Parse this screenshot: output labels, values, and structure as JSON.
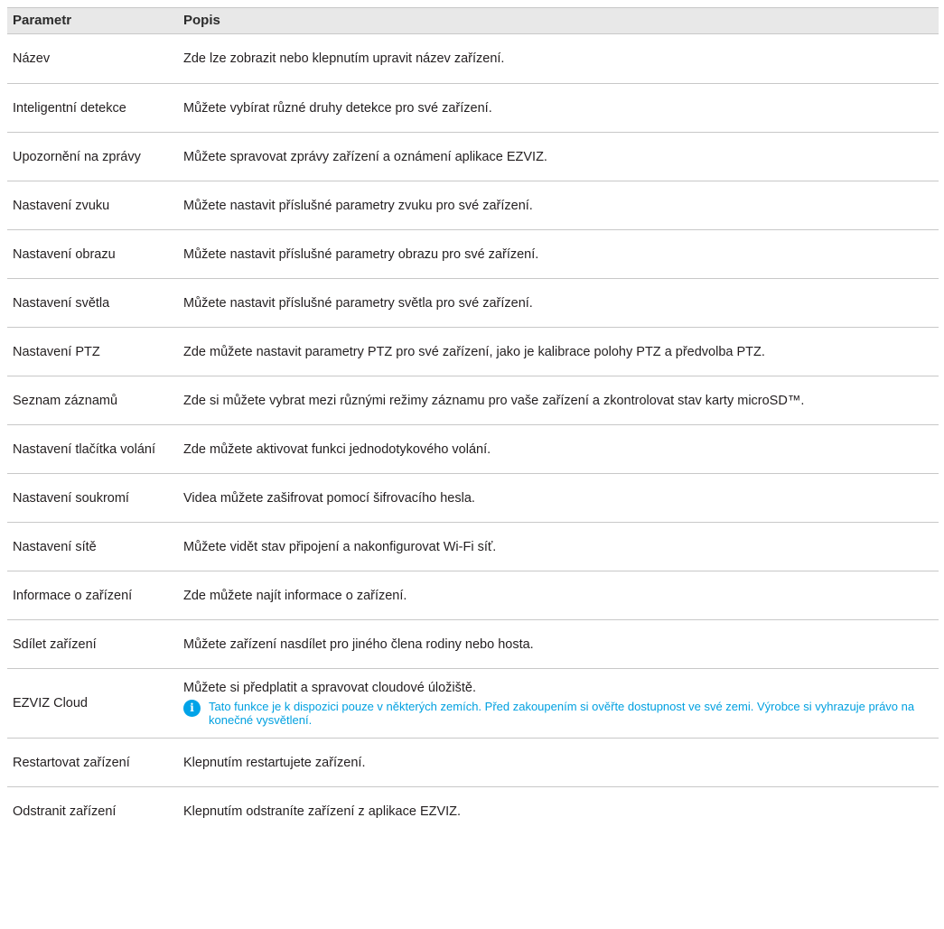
{
  "header": {
    "param": "Parametr",
    "desc": "Popis"
  },
  "rows": [
    {
      "param": "Název",
      "desc": "Zde lze zobrazit nebo klepnutím upravit název zařízení."
    },
    {
      "param": "Inteligentní detekce",
      "desc": "Můžete vybírat různé druhy detekce pro své zařízení."
    },
    {
      "param": "Upozornění na zprávy",
      "desc": "Můžete spravovat zprávy zařízení a oznámení aplikace EZVIZ."
    },
    {
      "param": "Nastavení zvuku",
      "desc": "Můžete nastavit příslušné parametry zvuku pro své zařízení."
    },
    {
      "param": "Nastavení obrazu",
      "desc": "Můžete nastavit příslušné parametry obrazu pro své zařízení."
    },
    {
      "param": "Nastavení světla",
      "desc": "Můžete nastavit příslušné parametry světla pro své zařízení."
    },
    {
      "param": "Nastavení PTZ",
      "desc": "Zde můžete nastavit parametry PTZ pro své zařízení, jako je kalibrace polohy PTZ a předvolba PTZ."
    },
    {
      "param": "Seznam záznamů",
      "desc": "Zde si můžete vybrat mezi různými režimy záznamu pro vaše zařízení a zkontrolovat stav karty microSD™."
    },
    {
      "param": "Nastavení tlačítka volání",
      "desc": "Zde můžete aktivovat funkci jednodotykového volání."
    },
    {
      "param": "Nastavení soukromí",
      "desc": "Videa můžete zašifrovat pomocí šifrovacího hesla."
    },
    {
      "param": "Nastavení sítě",
      "desc": "Můžete vidět stav připojení a nakonfigurovat Wi-Fi síť."
    },
    {
      "param": "Informace o zařízení",
      "desc": "Zde můžete najít informace o zařízení."
    },
    {
      "param": "Sdílet zařízení",
      "desc": "Můžete zařízení nasdílet pro jiného člena rodiny nebo hosta."
    },
    {
      "param": "EZVIZ Cloud",
      "desc": "Můžete si předplatit a spravovat cloudové úložiště.",
      "note": "Tato funkce je k dispozici pouze v některých zemích. Před zakoupením si ověřte dostupnost ve své zemi. Výrobce si vyhrazuje právo na konečné vysvětlení.",
      "note_icon": "i"
    },
    {
      "param": "Restartovat zařízení",
      "desc": "Klepnutím restartujete zařízení."
    },
    {
      "param": "Odstranit zařízení",
      "desc": "Klepnutím odstraníte zařízení z aplikace EZVIZ."
    }
  ],
  "colors": {
    "header_bg": "#e8e8e8",
    "border": "#c8c8c8",
    "note_text": "#00a0e0",
    "note_icon": "#00a3e8"
  }
}
